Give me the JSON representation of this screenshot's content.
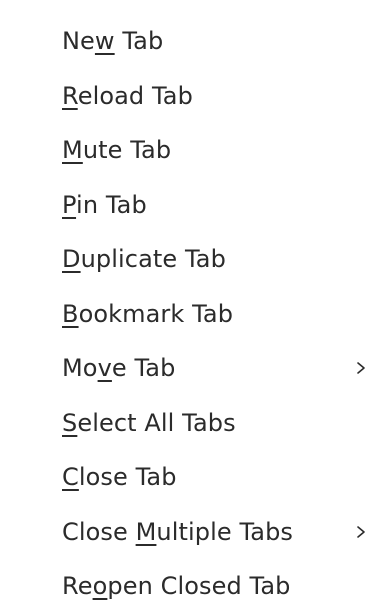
{
  "menu": {
    "items": [
      {
        "pre": "Ne",
        "accel": "w",
        "post": " Tab",
        "submenu": false
      },
      {
        "pre": "",
        "accel": "R",
        "post": "eload Tab",
        "submenu": false
      },
      {
        "pre": "",
        "accel": "M",
        "post": "ute Tab",
        "submenu": false
      },
      {
        "pre": "",
        "accel": "P",
        "post": "in Tab",
        "submenu": false
      },
      {
        "pre": "",
        "accel": "D",
        "post": "uplicate Tab",
        "submenu": false
      },
      {
        "pre": "",
        "accel": "B",
        "post": "ookmark Tab",
        "submenu": false
      },
      {
        "pre": "Mo",
        "accel": "v",
        "post": "e Tab",
        "submenu": true
      },
      {
        "pre": "",
        "accel": "S",
        "post": "elect All Tabs",
        "submenu": false
      },
      {
        "pre": "",
        "accel": "C",
        "post": "lose Tab",
        "submenu": false
      },
      {
        "pre": "Close ",
        "accel": "M",
        "post": "ultiple Tabs",
        "submenu": true
      },
      {
        "pre": "Re",
        "accel": "o",
        "post": "pen Closed Tab",
        "submenu": false
      }
    ],
    "submenu_icon": "chevron-right-icon",
    "text_color": "#2b2b2b",
    "background_color": "#ffffff"
  }
}
